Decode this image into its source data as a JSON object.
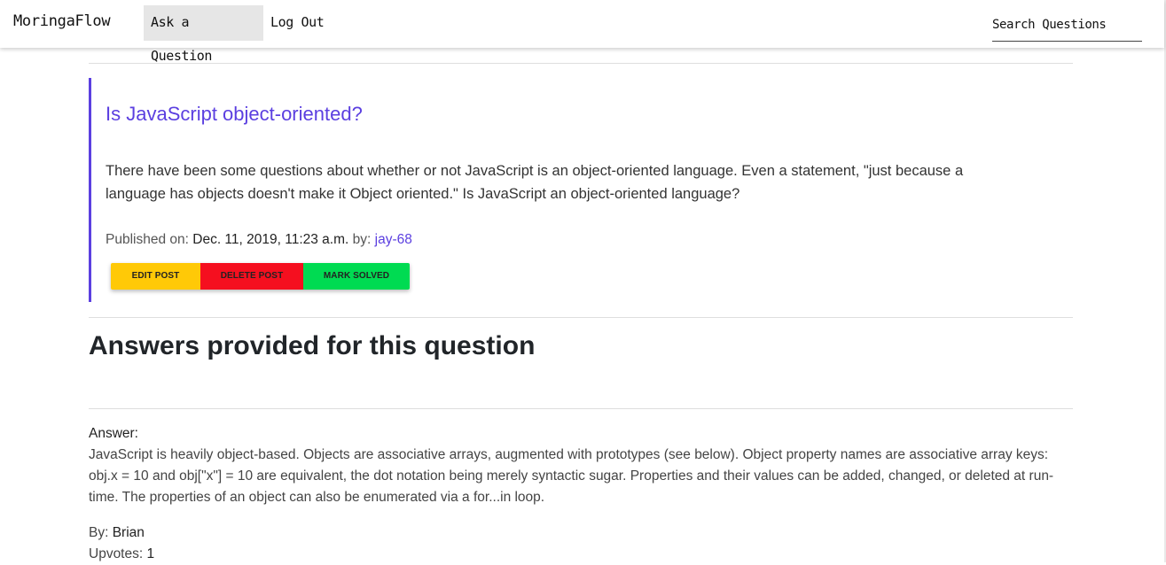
{
  "navbar": {
    "brand": "MoringaFlow",
    "ask_label": "Ask a Question",
    "logout_label": "Log Out",
    "search_placeholder": "Search Questions"
  },
  "question": {
    "title": "Is JavaScript object-oriented?",
    "body": "There have been some questions about whether or not JavaScript is an object-oriented language. Even a statement, \"just because a language has objects doesn't make it Object oriented.\" Is JavaScript an object-oriented language?",
    "published_label": "Published on:",
    "published_date": "Dec. 11, 2019, 11:23 a.m.",
    "by_label": "by:",
    "author": "jay-68",
    "accent_color": "#5b3fe0",
    "buttons": {
      "edit_label": "EDIT POST",
      "delete_label": "DELETE POST",
      "solve_label": "MARK SOLVED",
      "edit_color": "#ffc907",
      "delete_color": "#f50f1f",
      "solve_color": "#00db52"
    }
  },
  "answers": {
    "heading": "Answers provided for this question",
    "items": [
      {
        "label": "Answer:",
        "text": "JavaScript is heavily object-based. Objects are associative arrays, augmented with prototypes (see below). Object property names are associative array keys: obj.x = 10 and obj[\"x\"] = 10 are equivalent, the dot notation being merely syntactic sugar. Properties and their values can be added, changed, or deleted at run-time. The properties of an object can also be enumerated via a for...in loop.",
        "by_label": "By:",
        "author": "Brian",
        "upvotes_label": "Upvotes:",
        "upvotes": "1"
      }
    ]
  }
}
